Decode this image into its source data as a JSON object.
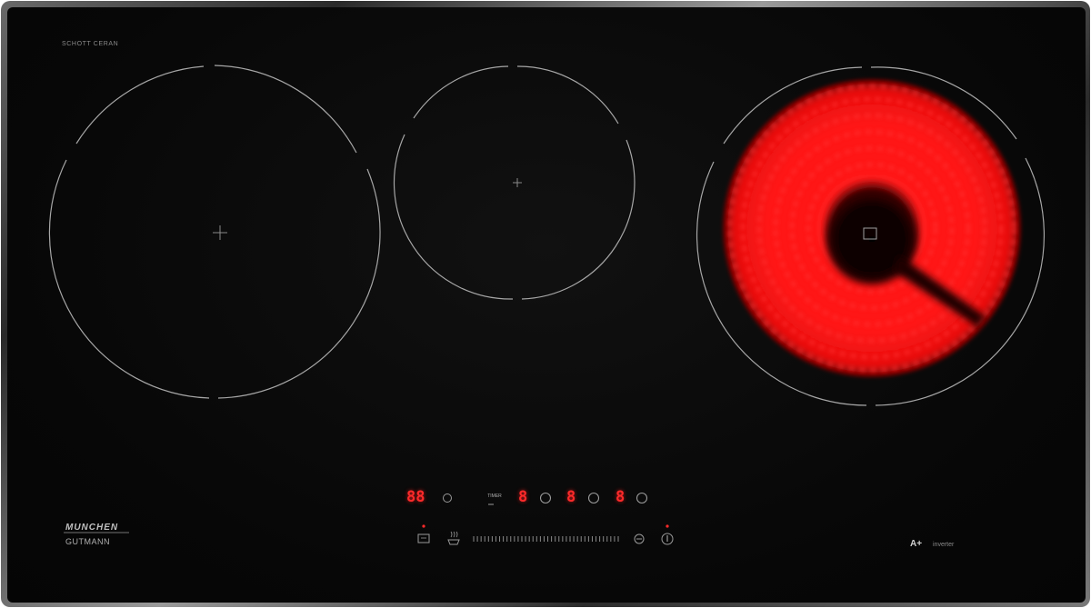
{
  "product": {
    "glass_brand": "SCHOTT CERAN",
    "glass_subtext": "",
    "top_marking": "",
    "brand_line1": "MUNCHEN",
    "brand_line2": "GUTMANN",
    "energy_class": "A+",
    "tech_label": "inverter"
  },
  "zones": [
    {
      "name": "left-induction-zone",
      "state": "off"
    },
    {
      "name": "middle-induction-zone",
      "state": "off"
    },
    {
      "name": "right-infrared-zone",
      "state": "on",
      "glow_color": "#ff1a1a"
    }
  ],
  "control_panel": {
    "timer_display": "88",
    "timer_label": "TIMER",
    "zone_displays": [
      "8",
      "8",
      "8"
    ],
    "slider_ticks": 40,
    "led_color": "#ff2a2a"
  },
  "colors": {
    "glass": "#080808",
    "frame": "#5a5a5a",
    "marking": "#9a9a9a",
    "heat": "#ff1a1a"
  },
  "icons": [
    "zone-select-icon",
    "lock-icon",
    "warm-icon",
    "minus-icon",
    "power-icon"
  ]
}
